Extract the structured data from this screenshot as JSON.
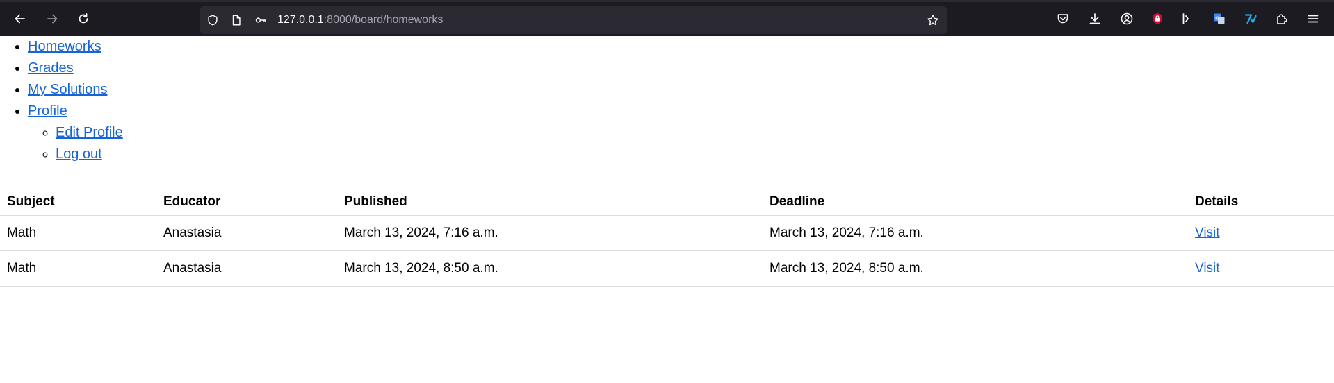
{
  "browser": {
    "url_host": "127.0.0.1",
    "url_path": ":8000/board/homeworks",
    "icons": [
      "back-icon",
      "forward-icon",
      "reload-icon",
      "shield-icon",
      "page-icon",
      "key-icon",
      "star-icon",
      "pocket-icon",
      "download-icon",
      "account-icon",
      "ublock-icon",
      "sidebar-icon",
      "translate-icon",
      "extension-icon",
      "puzzle-icon",
      "menu-icon"
    ]
  },
  "nav": {
    "items": [
      {
        "label": "Homeworks"
      },
      {
        "label": "Grades"
      },
      {
        "label": "My Solutions"
      },
      {
        "label": "Profile"
      }
    ],
    "profile_sub": [
      {
        "label": "Edit Profile"
      },
      {
        "label": "Log out"
      }
    ]
  },
  "table": {
    "headers": [
      "Subject",
      "Educator",
      "Published",
      "Deadline",
      "Details"
    ],
    "rows": [
      [
        "Math",
        "Anastasia",
        "March 13, 2024, 7:16 a.m.",
        "March 13, 2024, 7:16 a.m.",
        "Visit"
      ],
      [
        "Math",
        "Anastasia",
        "March 13, 2024, 8:50 a.m.",
        "March 13, 2024, 8:50 a.m.",
        "Visit"
      ]
    ]
  },
  "colors": {
    "chrome_bg": "#1c1b22",
    "urlbar_bg": "#2b2a33",
    "link": "#1565d8",
    "ublock_red": "#e0002b",
    "translate_blue": "#4285f4",
    "tool_cyan": "#2aa7e8"
  }
}
